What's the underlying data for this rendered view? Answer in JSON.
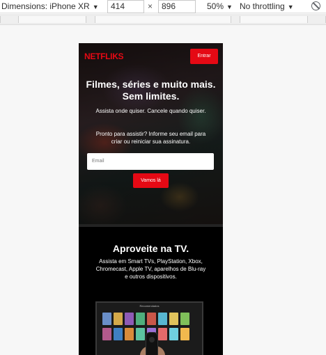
{
  "devtools": {
    "dimensions_label": "Dimensions: iPhone XR",
    "width": "414",
    "times": "×",
    "height": "896",
    "zoom": "50%",
    "throttling": "No throttling",
    "caret": "▼"
  },
  "hero": {
    "logo": "NETFLIKS",
    "signin_label": "Entrar",
    "title": "Filmes, séries e muito mais. Sem limites.",
    "subtitle": "Assista onde quiser. Cancele quando quiser.",
    "cta_text": "Pronto para assistir? Informe seu email para criar ou reiniciar sua assinatura.",
    "email_placeholder": "Email",
    "button_label": "Vamos lá"
  },
  "tv_section": {
    "title": "Aproveite na TV.",
    "text": "Assista em Smart TVs, PlayStation, Xbox, Chromecast, Apple TV, aparelhos de Blu-ray e outros dispositivos.",
    "screen_caption": "Recomendados"
  },
  "colors": {
    "brand": "#e50914",
    "background": "#000000"
  }
}
